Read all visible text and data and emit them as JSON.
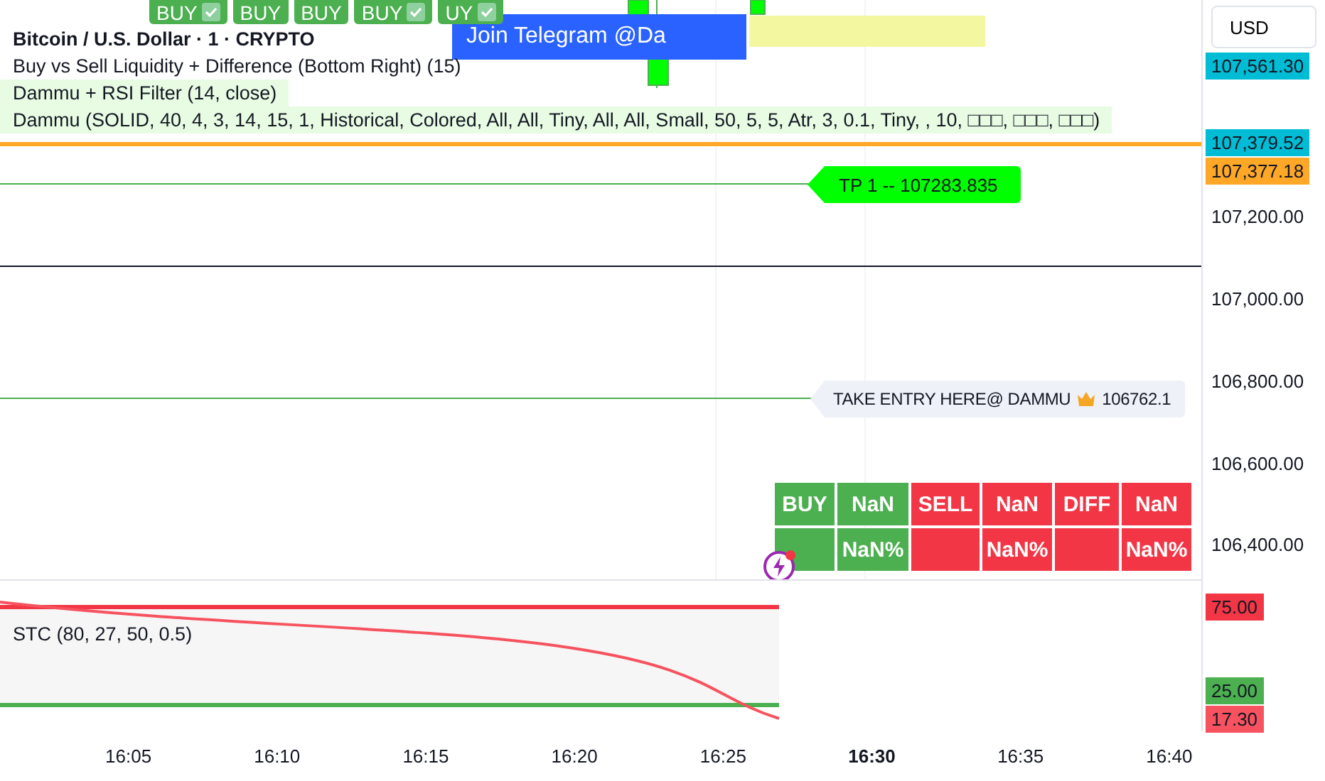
{
  "signals": [
    {
      "label": "BUY",
      "checked": true
    },
    {
      "label": "BUY",
      "checked": false
    },
    {
      "label": "BUY",
      "checked": false
    },
    {
      "label": "BUY",
      "checked": true
    },
    {
      "label": "UY",
      "checked": true
    }
  ],
  "banner": {
    "text": "Join Telegram @Da"
  },
  "legend": {
    "title": "Bitcoin / U.S. Dollar · 1 · CRYPTO",
    "indicators": [
      "Buy vs Sell Liquidity + Difference (Bottom Right) (15)",
      "Dammu + RSI Filter (14, close)",
      "Dammu (SOLID, 40, 4, 3, 14, 15, 1, Historical, Colored, All, All, Tiny, All, All, Small, 50, 5, 5, Atr, 3, 0.1, Tiny, , 10, □□□, □□□, □□□)"
    ]
  },
  "target": {
    "text": "TP 1 --  107283.835"
  },
  "entry": {
    "text": "TAKE ENTRY HERE@ DAMMU",
    "price": "106762.1"
  },
  "liquidity_table": {
    "rows": [
      [
        {
          "text": "BUY",
          "kind": "buy"
        },
        {
          "text": "NaN",
          "kind": "buy"
        },
        {
          "text": "SELL",
          "kind": "sell"
        },
        {
          "text": "NaN",
          "kind": "sell"
        },
        {
          "text": "DIFF",
          "kind": "sell"
        },
        {
          "text": "NaN",
          "kind": "sell"
        }
      ],
      [
        {
          "kind": "buy"
        },
        {
          "text": "NaN%",
          "kind": "buy"
        },
        {
          "kind": "sell"
        },
        {
          "text": "NaN%",
          "kind": "sell"
        },
        {
          "kind": "sell"
        },
        {
          "text": "NaN%",
          "kind": "sell"
        }
      ]
    ]
  },
  "oscillator": {
    "legend": "STC (80, 27, 50, 0.5)"
  },
  "price_axis": {
    "currency": "USD",
    "labels": [
      {
        "text": "107,561.30",
        "color": "#00bcd4"
      },
      {
        "text": "107,379.52",
        "color": "#00bcd4"
      },
      {
        "text": "107,377.18",
        "color": "#ffa726"
      },
      {
        "text": "107,200.00"
      },
      {
        "text": "107,000.00"
      },
      {
        "text": "106,800.00"
      },
      {
        "text": "106,600.00"
      },
      {
        "text": "106,400.00"
      },
      {
        "text": "75.00",
        "color": "#f23645"
      },
      {
        "text": "25.00",
        "color": "#4caf50"
      },
      {
        "text": "17.30",
        "color": "#f7525f"
      }
    ]
  },
  "time_axis": [
    {
      "label": "16:05",
      "bold": false
    },
    {
      "label": "16:10",
      "bold": false
    },
    {
      "label": "16:15",
      "bold": false
    },
    {
      "label": "16:20",
      "bold": false
    },
    {
      "label": "16:25",
      "bold": false
    },
    {
      "label": "16:30",
      "bold": true
    },
    {
      "label": "16:35",
      "bold": false
    },
    {
      "label": "16:40",
      "bold": false
    }
  ]
}
